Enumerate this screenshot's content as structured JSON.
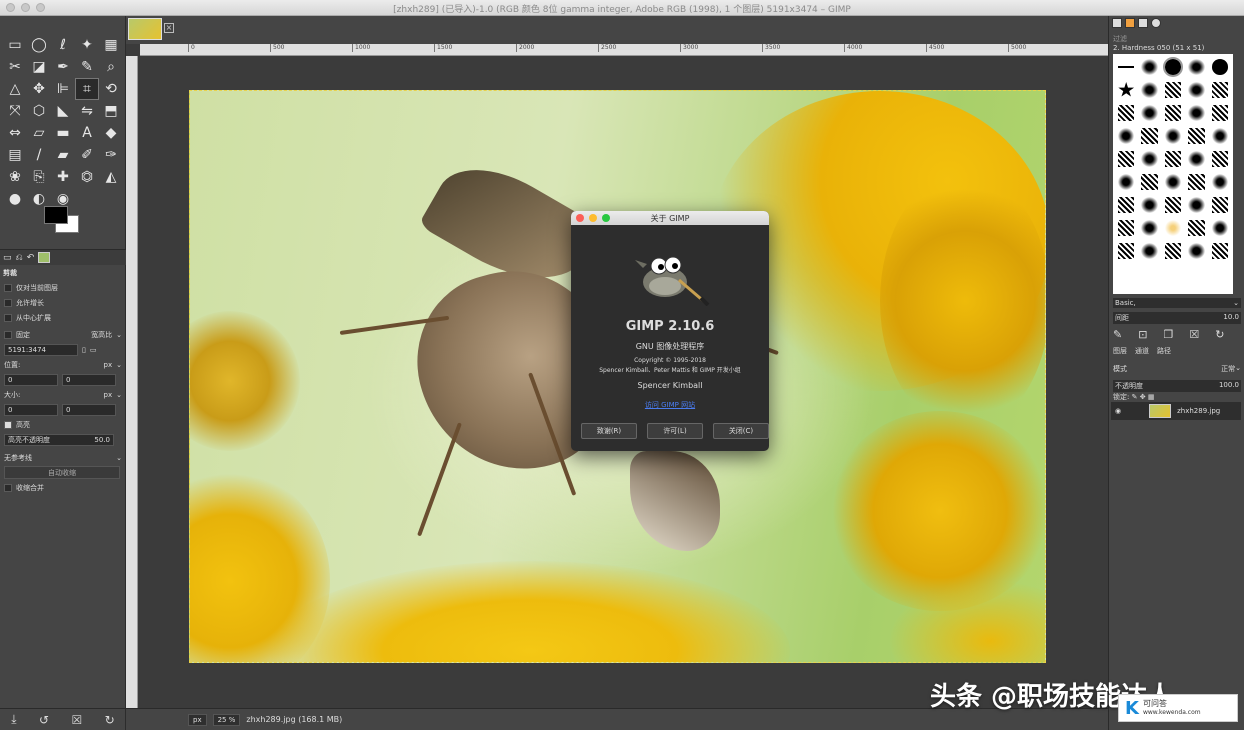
{
  "window": {
    "title": "[zhxh289] (已导入)-1.0 (RGB 颜色 8位 gamma integer, Adobe RGB (1998), 1 个图层) 5191x3474 – GIMP"
  },
  "tool_options": {
    "title": "剪裁",
    "current_layer_only": "仅对当前图层",
    "allow_growing": "允许增长",
    "expand_from_center": "从中心扩展",
    "fixed_label": "固定",
    "fixed_mode": "宽高比",
    "ratio_value": "5191:3474",
    "position_label": "位置:",
    "position_unit": "px",
    "position_x": "0",
    "position_y": "0",
    "size_label": "大小:",
    "size_unit": "px",
    "size_w": "0",
    "size_h": "0",
    "highlight_label": "高亮",
    "highlight_opacity_label": "高亮不透明度",
    "highlight_opacity_value": "50.0",
    "guides_value": "无参考线",
    "auto_shrink": "自动收缩",
    "shrink_merged": "收缩合并"
  },
  "ruler_ticks": [
    "0",
    "500",
    "1000",
    "1500",
    "2000",
    "2500",
    "3000",
    "3500",
    "4000",
    "4500",
    "5000"
  ],
  "status": {
    "unit": "px",
    "zoom": "25 %",
    "file": "zhxh289.jpg (168.1 MB)"
  },
  "dock": {
    "filter_placeholder": "过滤",
    "brush_name": "2. Hardness 050 (51 x 51)",
    "brush_preset": "Basic,",
    "spacing_label": "间距",
    "spacing_value": "10.0",
    "tabs": [
      "图层",
      "通道",
      "路径"
    ],
    "mode_label": "模式",
    "mode_value": "正常",
    "opacity_label": "不透明度",
    "opacity_value": "100.0",
    "lock_label": "锁定:",
    "layer_name": "zhxh289.jpg"
  },
  "dialog": {
    "title": "关于 GIMP",
    "app": "GIMP 2.10.6",
    "subtitle": "GNU 图像处理程序",
    "copyright": "Copyright © 1995-2018",
    "authors": "Spencer Kimball、Peter Mattis 和 GIMP 开发小组",
    "credit": "Spencer Kimball",
    "link": "访问 GIMP 网站",
    "btn_thanks": "致谢(R)",
    "btn_license": "许可(L)",
    "btn_close": "关闭(C)"
  },
  "watermark": {
    "text": "头条 @职场技能达人",
    "logo_letter": "K",
    "logo_name": "可问答",
    "logo_url": "www.kewenda.com"
  }
}
